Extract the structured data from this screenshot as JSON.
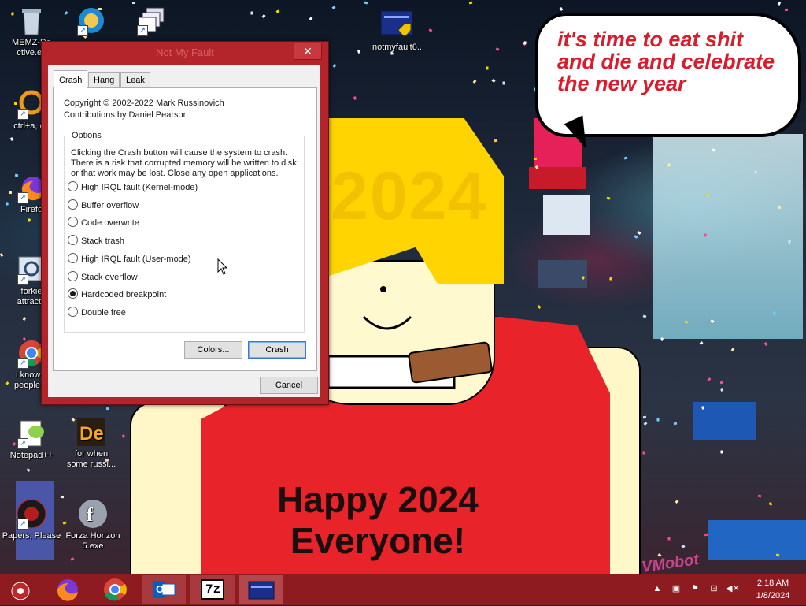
{
  "desktop": {
    "icons": [
      {
        "label": "MEMZ-Destructive.exe",
        "line1": "MEMZ-De",
        "line2": "ctive.ex"
      },
      {
        "label": "ctrl+a, enter",
        "line1": "ctrl+a, en",
        "line2": ""
      },
      {
        "label": "Firefox",
        "line1": "Firefo",
        "line2": ""
      },
      {
        "label": "forkie attracta",
        "line1": "forkie",
        "line2": "attracta"
      },
      {
        "label": "i know your people",
        "line1": "i know y",
        "line2": "people w"
      },
      {
        "label": "Notepad++",
        "line1": "Notepad++",
        "line2": ""
      },
      {
        "label": "Papers, Please",
        "line1": "Papers, Please",
        "line2": ""
      },
      {
        "label": "for when some russi...",
        "line1": "for when",
        "line2": "some russi..."
      },
      {
        "label": "Forza Horizon 5.exe",
        "line1": "Forza Horizon",
        "line2": "5.exe"
      },
      {
        "label": "notmyfault",
        "line1": "notmyfault6...",
        "line2": ""
      }
    ],
    "bubble_text": "it's time to eat shit and die and celebrate the new year",
    "bubble_line1": "it's time to eat shit",
    "bubble_line2": "and die and celebrate",
    "bubble_line3": "the new year",
    "shirt_line1": "Happy 2024",
    "shirt_line2": "Everyone!",
    "hair_year": "2024",
    "signature": "VMobot"
  },
  "window": {
    "title": "Not My Fault",
    "close_glyph": "✕",
    "tabs": [
      {
        "label": "Crash",
        "active": true
      },
      {
        "label": "Hang",
        "active": false
      },
      {
        "label": "Leak",
        "active": false
      }
    ],
    "copyright": "Copyright © 2002-2022 Mark Russinovich",
    "contributions": "Contributions by Daniel Pearson",
    "options_label": "Options",
    "warning": "Clicking the Crash button will cause the system to crash. There is a risk that corrupted memory will be written to disk or that work may be lost. Close any open applications.",
    "warning_line1": "Clicking the Crash button will cause the system to crash.",
    "warning_line2": "There is a risk that corrupted memory will be written to disk",
    "warning_line3": "or that work may be lost. Close any open applications.",
    "options": [
      {
        "label": "High IRQL fault (Kernel-mode)",
        "selected": false
      },
      {
        "label": "Buffer overflow",
        "selected": false
      },
      {
        "label": "Code overwrite",
        "selected": false
      },
      {
        "label": "Stack trash",
        "selected": false
      },
      {
        "label": "High IRQL fault (User-mode)",
        "selected": false
      },
      {
        "label": "Stack overflow",
        "selected": false
      },
      {
        "label": "Hardcoded breakpoint",
        "selected": true
      },
      {
        "label": "Double free",
        "selected": false
      }
    ],
    "colors_button": "Colors...",
    "crash_button": "Crash",
    "cancel_button": "Cancel"
  },
  "taskbar": {
    "items": [
      {
        "name": "start-button",
        "icon": "start-orb-icon"
      },
      {
        "name": "firefox",
        "icon": "firefox-icon"
      },
      {
        "name": "chrome",
        "icon": "chrome-icon"
      },
      {
        "name": "outlook",
        "icon": "outlook-icon"
      },
      {
        "name": "7zip",
        "icon": "7zip-icon"
      },
      {
        "name": "notmyfault",
        "icon": "notmyfault-icon"
      }
    ],
    "sevenzip_label": "7z",
    "outlook_label": "O",
    "time": "2:18 AM",
    "date": "1/8/2024"
  },
  "colors": {
    "taskbar": "#8e1b1f",
    "window_frame": "#b3242b",
    "shirt": "#e8242a",
    "hair": "#ffd400",
    "bubble_text": "#d91c2c"
  }
}
